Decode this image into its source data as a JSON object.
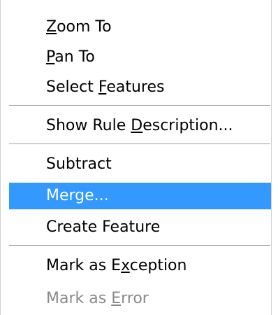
{
  "menu": {
    "items": [
      {
        "pre": "",
        "key": "Z",
        "post": "oom To",
        "state": "normal"
      },
      {
        "pre": "",
        "key": "P",
        "post": "an To",
        "state": "normal"
      },
      {
        "pre": "Select ",
        "key": "F",
        "post": "eatures",
        "state": "normal"
      },
      {
        "pre": "Show Rule ",
        "key": "D",
        "post": "escription...",
        "state": "normal"
      },
      {
        "pre": "Subtract",
        "key": "",
        "post": "",
        "state": "normal"
      },
      {
        "pre": "Merge...",
        "key": "",
        "post": "",
        "state": "highlighted"
      },
      {
        "pre": "Create Feature",
        "key": "",
        "post": "",
        "state": "normal"
      },
      {
        "pre": "Mark as E",
        "key": "x",
        "post": "ception",
        "state": "normal"
      },
      {
        "pre": "Mark as ",
        "key": "E",
        "post": "rror",
        "state": "disabled"
      }
    ]
  },
  "colors": {
    "highlight": "#3399ff",
    "disabled_text": "#8a8a8a",
    "separator": "#a0a0a0"
  }
}
